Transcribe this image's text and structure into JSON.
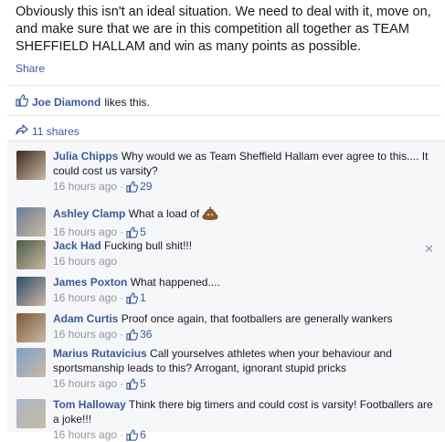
{
  "post": {
    "text": "Obviously this isn't an ideal situation. We need to deal with it, move on, and make sure that we are in this competition all together as TEAM SHEFFIELD HALLAM and win as many points as possible.",
    "share_label": "Share"
  },
  "likes": {
    "name": "Joe Diamond",
    "suffix": "likes this."
  },
  "shares": {
    "label": "11 shares"
  },
  "comments": [
    {
      "author": "Julia Chipps",
      "text": "Why would we as Team Sheffield Hallam ever agree to this.... It could cost us varsity?",
      "time": "16 hours ago",
      "likes": "29",
      "avatar_color": "#3a2a22"
    },
    {
      "author": "Ashley Clamp",
      "text": "What a load of",
      "time": "16 hours ago",
      "likes": "5",
      "avatar_color": "#6b7f96",
      "emoji": "poop-emoji"
    },
    {
      "author": "Jack Had",
      "text": "Fucking bull shit!!!",
      "time": "16 hours ago",
      "likes": "",
      "avatar_color": "#4a5a4a"
    },
    {
      "author": "James Poxton",
      "text": "What happened....",
      "time": "16 hours ago",
      "likes": "1",
      "avatar_color": "#2f4a6a"
    },
    {
      "author": "Adam Curtis",
      "text": "Proof once again, that footballers are generally wankers",
      "time": "16 hours ago",
      "likes": "36",
      "avatar_color": "#7a5a3a"
    },
    {
      "author": "Marius Rutavicius",
      "text": "Call yourselves athletes when your behaviour and sportsmanship leads to this? Arrogant, ignorant stupid pricks",
      "time": "16 hours ago",
      "likes": "5",
      "avatar_color": "#7fa0c8"
    },
    {
      "author": "Tom Halloway",
      "text": "Think there big timers and could cost is varsity! Footballers are a joke!!!",
      "time": "16 hours ago",
      "likes": "6",
      "avatar_color": "#a7b7c5"
    }
  ]
}
